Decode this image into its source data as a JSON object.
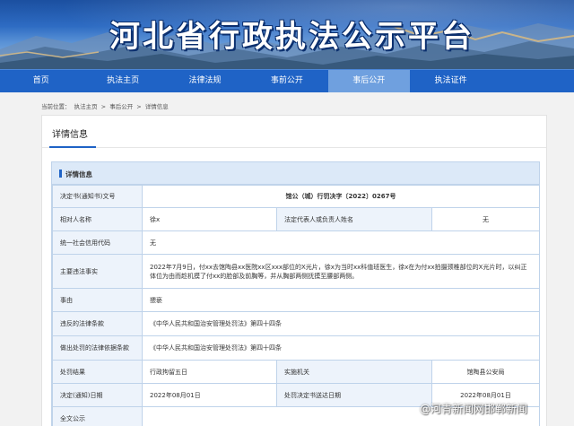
{
  "header": {
    "title": "河北省行政执法公示平台"
  },
  "nav": {
    "items": [
      "首页",
      "执法主页",
      "法律法规",
      "事前公开",
      "事后公开",
      "执法证件"
    ],
    "active_index": 4
  },
  "breadcrumb": {
    "items": [
      "当前位置：",
      "执法主页",
      ">",
      "事后公开",
      ">",
      "详情信息"
    ]
  },
  "panel": {
    "title": "详情信息"
  },
  "detail": {
    "section_title": "详情信息",
    "doc_number": {
      "label": "决定书(通知书)文号",
      "value": "馆公（城）行罚决字〔2022〕0267号"
    },
    "party": {
      "label": "相对人名称",
      "value": "徐x",
      "legal_label": "法定代表人或负责人姓名",
      "legal_value": "无"
    },
    "credit_code": {
      "label": "统一社会信用代码",
      "value": "无"
    },
    "facts": {
      "label": "主要违法事实",
      "value": "2022年7月9日，付xx去馆陶县xx医院xx区xxx部位的X光片，徐x为当时xx科值班医生，徐x在为付xx拍摄颈椎部位的X光片时，以纠正体位为由而趁机摸了付xx的脸部及前胸等，并从胸部两侧抚摸至腰部两侧。"
    },
    "reason": {
      "label": "事由",
      "value": "猥亵"
    },
    "violated_law": {
      "label": "违反的法律条款",
      "value": "《中华人民共和国治安管理处罚法》第四十四条"
    },
    "basis_law": {
      "label": "做出处罚的法律依据条款",
      "value": "《中华人民共和国治安管理处罚法》第四十四条"
    },
    "result": {
      "label": "处罚结果",
      "value": "行政拘留五日",
      "agency_label": "实施机关",
      "agency_value": "馆陶县公安局"
    },
    "dates": {
      "label": "决定(通知)日期",
      "value": "2022年08月01日",
      "service_label": "处罚决定书送达日期",
      "service_value": "2022年08月01日"
    },
    "fulltext": {
      "label": "全文公示",
      "value": ""
    }
  },
  "watermark": {
    "text": "@河青新闻网邯郸新闻"
  }
}
